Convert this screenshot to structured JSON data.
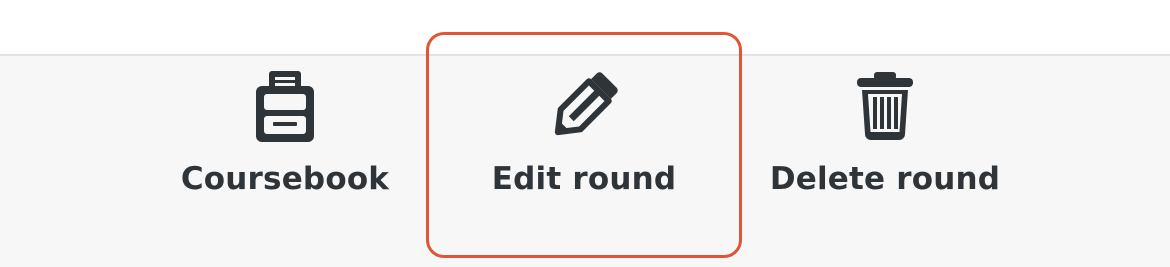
{
  "toolbar": {
    "actions": [
      {
        "label": "Coursebook",
        "icon": "coursebook-icon"
      },
      {
        "label": "Edit round",
        "icon": "pencil-icon"
      },
      {
        "label": "Delete round",
        "icon": "trash-icon"
      }
    ]
  },
  "colors": {
    "toolbar_background": "#f7f7f7",
    "text": "#2f3439",
    "highlight": "#e05535",
    "divider": "#e2e2e2"
  }
}
